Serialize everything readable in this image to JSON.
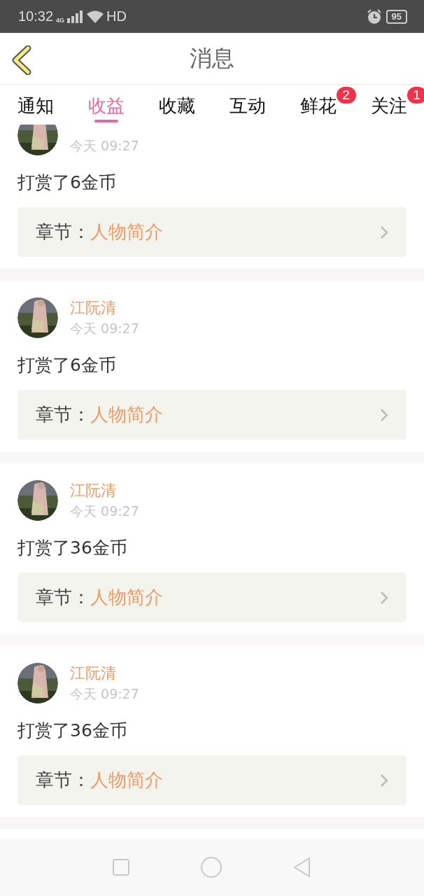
{
  "status_bar": {
    "time": "10:32",
    "network": "4G",
    "hd": "HD",
    "battery": "95"
  },
  "header": {
    "title": "消息"
  },
  "tabs": [
    {
      "label": "通知",
      "selected": false
    },
    {
      "label": "收益",
      "selected": true
    },
    {
      "label": "收藏",
      "selected": false
    },
    {
      "label": "互动",
      "selected": false
    },
    {
      "label": "鲜花",
      "selected": false,
      "badge": "2"
    },
    {
      "label": "关注",
      "selected": false,
      "badge": "1"
    }
  ],
  "messages": [
    {
      "time": "今天 09:27",
      "text": "打赏了6金币",
      "chapter_label": "章节：",
      "chapter": "人物简介"
    },
    {
      "name": "江阮清",
      "time": "今天 09:27",
      "text": "打赏了6金币",
      "chapter_label": "章节：",
      "chapter": "人物简介"
    },
    {
      "name": "江阮清",
      "time": "今天 09:27",
      "text": "打赏了36金币",
      "chapter_label": "章节：",
      "chapter": "人物简介"
    },
    {
      "name": "江阮清",
      "time": "今天 09:27",
      "text": "打赏了36金币",
      "chapter_label": "章节：",
      "chapter": "人物简介"
    }
  ]
}
